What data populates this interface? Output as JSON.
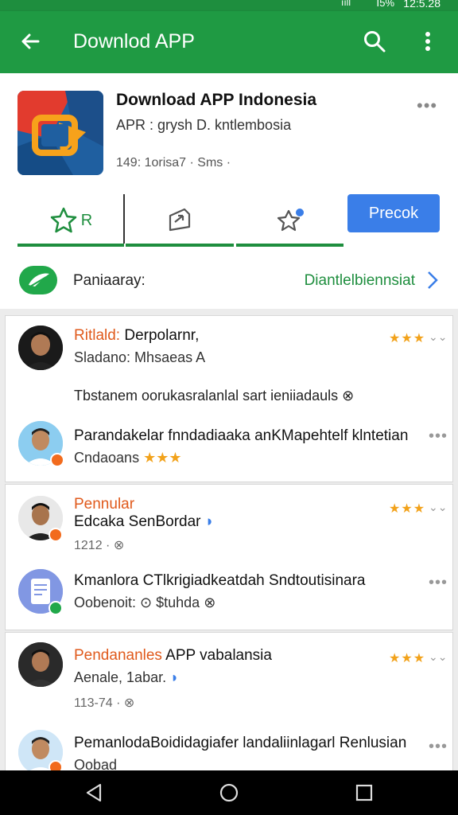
{
  "status": {
    "signal": "ııll",
    "battery": "Ⅰ5%",
    "time": "12:5.28"
  },
  "appbar": {
    "title": "Downlod APP"
  },
  "app": {
    "name": "Download APP Indonesia",
    "developer": "APR : grysh D. kntlembosia",
    "meta": "149: 1orisa7 · Sms ·"
  },
  "tabs": [
    {
      "label": "R"
    },
    {
      "label": ""
    },
    {
      "label": ""
    }
  ],
  "primary_button": "Precok",
  "download_row": {
    "label": "Paniaaray:",
    "link": "Diantlelbiennsiat"
  },
  "reviews": [
    {
      "name_highlight": "Ritlald: ",
      "name": "Derpolarnr,",
      "subtitle": "Sladano: Mhsaeas A",
      "body": "Tbstanem oorukasralanlal sart ieniiadauls ⊗",
      "stars": "★★★",
      "chevron": "⌄⌄"
    },
    {
      "name": "Parandakelar fnndadiaaka anKMapehtelf klntetian",
      "subtitle": "Cndaoans",
      "stars": "★★★",
      "dots": "•••"
    },
    {
      "name_highlight": "Pennular",
      "name": "Edcaka SenBordar",
      "date": "1212 · ⊗",
      "stars": "★★★",
      "chevron": "⌄⌄"
    },
    {
      "name": "Kmanlora CTlkrigiadkeatdah Sndtoutisinara",
      "subtitle": "Oobenoit: ⊙ $tuhda ⊗",
      "dots": "•••"
    },
    {
      "name_highlight": "Pendananles",
      "name": " APP vabalansia",
      "subtitle": "Aenale, 1abar.",
      "date": "113-74 · ⊗",
      "stars": "★★★",
      "chevron": "⌄⌄"
    },
    {
      "name": "PemanlodaBoididagiafer landaliinlagarl Renlusian",
      "subtitle": "Oobad",
      "dots": "•••"
    }
  ],
  "colors": {
    "primary": "#1f9a43",
    "accent": "#3a7ee8",
    "star": "#f2a21b",
    "highlight": "#e05a1c"
  }
}
